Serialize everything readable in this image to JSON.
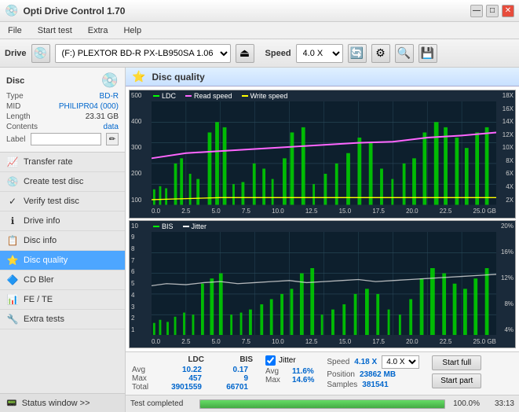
{
  "app": {
    "title": "Opti Drive Control 1.70",
    "icon": "💿"
  },
  "titlebar": {
    "minimize": "—",
    "maximize": "□",
    "close": "✕"
  },
  "menubar": {
    "items": [
      "File",
      "Start test",
      "Extra",
      "Help"
    ]
  },
  "toolbar": {
    "drive_label": "Drive",
    "drive_value": "(F:) PLEXTOR BD-R  PX-LB950SA 1.06",
    "speed_label": "Speed",
    "speed_value": "4.0 X"
  },
  "disc": {
    "label": "Disc",
    "type_key": "Type",
    "type_val": "BD-R",
    "mid_key": "MID",
    "mid_val": "PHILIPR04 (000)",
    "length_key": "Length",
    "length_val": "23.31 GB",
    "contents_key": "Contents",
    "contents_val": "data",
    "label_key": "Label",
    "label_val": ""
  },
  "nav": {
    "items": [
      {
        "id": "transfer-rate",
        "label": "Transfer rate",
        "icon": "📈"
      },
      {
        "id": "create-test-disc",
        "label": "Create test disc",
        "icon": "💿"
      },
      {
        "id": "verify-test-disc",
        "label": "Verify test disc",
        "icon": "✓"
      },
      {
        "id": "drive-info",
        "label": "Drive info",
        "icon": "ℹ"
      },
      {
        "id": "disc-info",
        "label": "Disc info",
        "icon": "📋"
      },
      {
        "id": "disc-quality",
        "label": "Disc quality",
        "icon": "⭐",
        "active": true
      },
      {
        "id": "cd-bler",
        "label": "CD Bler",
        "icon": "🔷"
      },
      {
        "id": "fe-te",
        "label": "FE / TE",
        "icon": "📊"
      },
      {
        "id": "extra-tests",
        "label": "Extra tests",
        "icon": "🔧"
      }
    ]
  },
  "status_window": {
    "label": "Status window >>",
    "icon": "📟"
  },
  "disc_quality": {
    "title": "Disc quality",
    "icon": "⭐"
  },
  "chart_upper": {
    "legend": [
      {
        "label": "LDC",
        "color": "#00ff00"
      },
      {
        "label": "Read speed",
        "color": "#ff66ff"
      },
      {
        "label": "Write speed",
        "color": "#ffff00"
      }
    ],
    "y_axis_left": [
      "500",
      "400",
      "300",
      "200",
      "100"
    ],
    "y_axis_right": [
      "18X",
      "16X",
      "14X",
      "12X",
      "10X",
      "8X",
      "6X",
      "4X",
      "2X"
    ],
    "x_axis": [
      "0.0",
      "2.5",
      "5.0",
      "7.5",
      "10.0",
      "12.5",
      "15.0",
      "17.5",
      "20.0",
      "22.5",
      "25.0 GB"
    ]
  },
  "chart_lower": {
    "legend": [
      {
        "label": "BIS",
        "color": "#00ff00"
      },
      {
        "label": "Jitter",
        "color": "#ffffff"
      }
    ],
    "y_axis_left": [
      "10",
      "9",
      "8",
      "7",
      "6",
      "5",
      "4",
      "3",
      "2",
      "1"
    ],
    "y_axis_right": [
      "20%",
      "16%",
      "12%",
      "8%",
      "4%"
    ],
    "x_axis": [
      "0.0",
      "2.5",
      "5.0",
      "7.5",
      "10.0",
      "12.5",
      "15.0",
      "17.5",
      "20.0",
      "22.5",
      "25.0 GB"
    ]
  },
  "stats": {
    "ldc_header": "LDC",
    "bis_header": "BIS",
    "avg_label": "Avg",
    "ldc_avg": "10.22",
    "bis_avg": "0.17",
    "max_label": "Max",
    "ldc_max": "457",
    "bis_max": "9",
    "total_label": "Total",
    "ldc_total": "3901559",
    "bis_total": "66701",
    "jitter_label": "Jitter",
    "jitter_avg": "11.6%",
    "jitter_max": "14.6%",
    "jitter_total": "",
    "speed_label": "Speed",
    "speed_val": "4.18 X",
    "speed_combo": "4.0 X",
    "position_label": "Position",
    "position_val": "23862 MB",
    "samples_label": "Samples",
    "samples_val": "381541",
    "start_full_label": "Start full",
    "start_part_label": "Start part"
  },
  "progress": {
    "label": "Test completed",
    "percent": 100,
    "percent_display": "100.0%",
    "time": "33:13"
  }
}
